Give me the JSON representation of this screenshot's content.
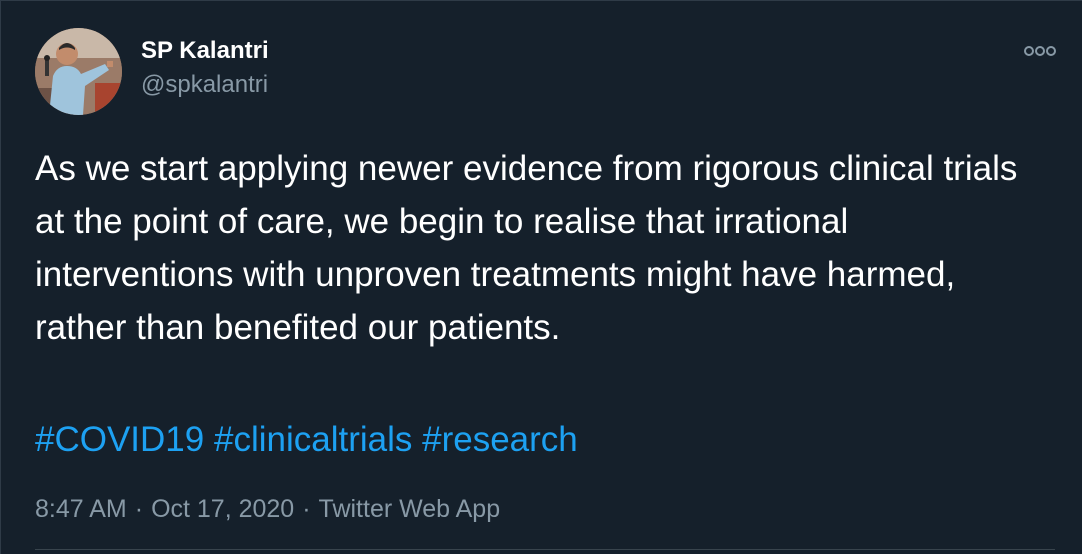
{
  "author": {
    "name": "SP Kalantri",
    "handle": "@spkalantri",
    "avatar_icon": "profile-photo-person-speaking"
  },
  "tweet": {
    "text": "As we start applying newer evidence from rigorous clinical trials at the point of care, we begin to realise that irrational interventions with unproven treatments might have harmed, rather than benefited our patients.",
    "hashtags": [
      "#COVID19",
      "#clinicaltrials",
      "#research"
    ]
  },
  "meta": {
    "time": "8:47 AM",
    "separator": "·",
    "date": "Oct 17, 2020",
    "source": "Twitter Web App"
  },
  "menu": {
    "icon": "more-options-icon"
  },
  "colors": {
    "background": "#15202b",
    "text_primary": "#ffffff",
    "text_secondary": "#8899a6",
    "link": "#1da1f2"
  }
}
